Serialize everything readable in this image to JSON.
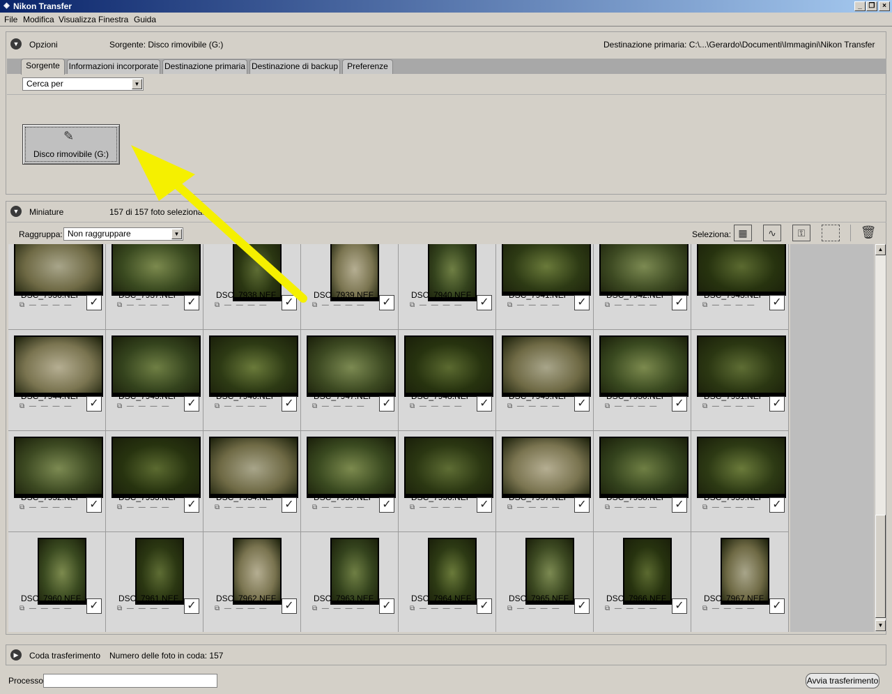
{
  "window": {
    "title": "Nikon Transfer"
  },
  "menu": [
    "File",
    "Modifica",
    "Visualizza",
    "Finestra",
    "Guida"
  ],
  "options": {
    "label": "Opzioni",
    "source": "Sorgente: Disco rimovibile (G:)",
    "dest": "Destinazione primaria:  C:\\...\\Gerardo\\Documenti\\Immagini\\Nikon Transfer",
    "tabs": [
      "Sorgente",
      "Informazioni incorporate",
      "Destinazione primaria",
      "Destinazione di backup",
      "Preferenze"
    ],
    "search": "Cerca per",
    "disk": "Disco rimovibile (G:)"
  },
  "thumbs": {
    "label": "Miniature",
    "count": "157 di 157 foto selezionate",
    "group_label": "Raggruppa:",
    "group_value": "Non raggruppare",
    "select_label": "Seleziona:",
    "meta": "— — — —",
    "files": [
      "DSC_7936.NEF",
      "DSC_7937.NEF",
      "DSC_7938.NEF",
      "DSC_7939.NEF",
      "DSC_7940.NEF",
      "DSC_7941.NEF",
      "DSC_7942.NEF",
      "DSC_7943.NEF",
      "DSC_7944.NEF",
      "DSC_7945.NEF",
      "DSC_7946.NEF",
      "DSC_7947.NEF",
      "DSC_7948.NEF",
      "DSC_7949.NEF",
      "DSC_7950.NEF",
      "DSC_7951.NEF",
      "DSC_7952.NEF",
      "DSC_7953.NEF",
      "DSC_7954.NEF",
      "DSC_7955.NEF",
      "DSC_7956.NEF",
      "DSC_7957.NEF",
      "DSC_7958.NEF",
      "DSC_7959.NEF",
      "DSC_7960.NEF",
      "DSC_7961.NEF",
      "DSC_7962.NEF",
      "DSC_7963.NEF",
      "DSC_7964.NEF",
      "DSC_7965.NEF",
      "DSC_7966.NEF",
      "DSC_7967.NEF"
    ]
  },
  "queue": {
    "label": "Coda trasferimento",
    "count": "Numero delle foto in coda: 157"
  },
  "footer": {
    "process_label": "Processo:",
    "process_value": "",
    "start": "Avvia trasferimento"
  }
}
